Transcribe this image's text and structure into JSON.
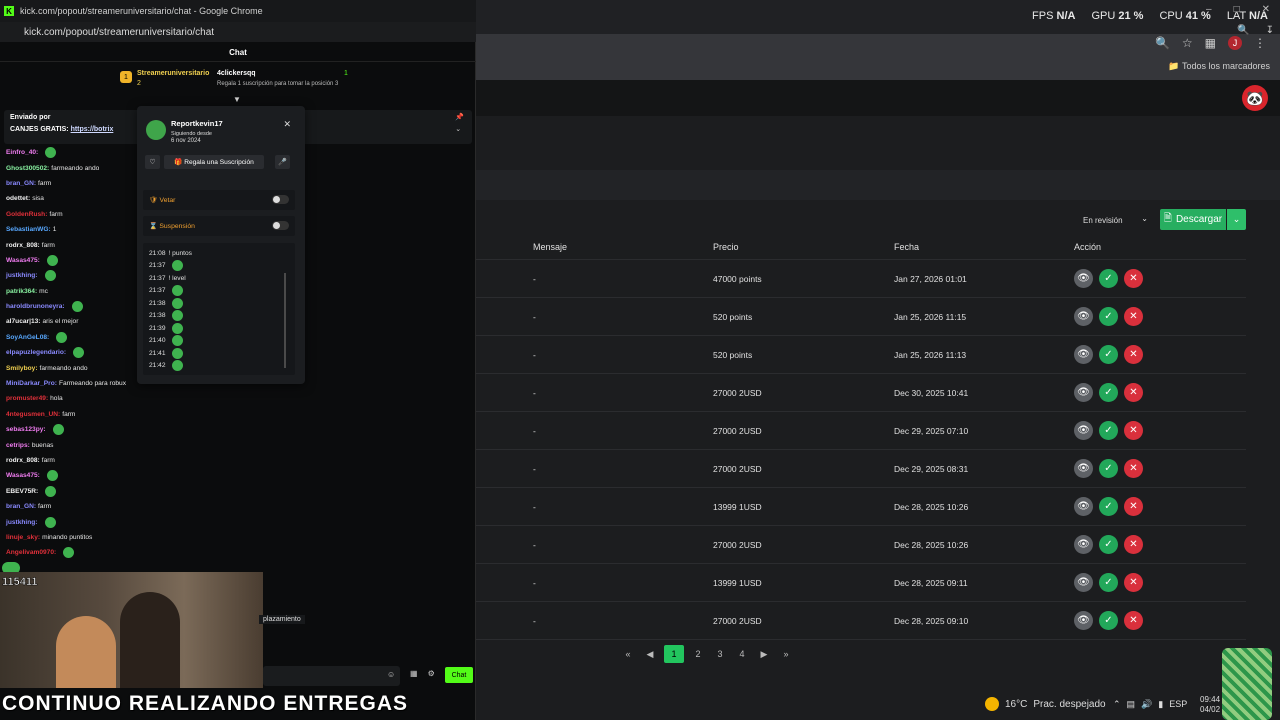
{
  "chrome": {
    "title": "kick.com/popout/streameruniversitario/chat - Google Chrome",
    "url": "kick.com/popout/streameruniversitario/chat"
  },
  "chat": {
    "header": "Chat",
    "leader": {
      "name": "Streameruniversitario",
      "count": "2",
      "gift_user": "4clickersqq",
      "gift_count": "1",
      "gift_hint": "Regala 1 suscripción para tomar la posición 3"
    },
    "pinned": {
      "sent_by": "Enviado por",
      "message_prefix": "CANJES GRATIS:",
      "link": "https://botrix"
    },
    "messages": [
      {
        "user": "Einfro_40:",
        "text": "",
        "color": "#f07cf0",
        "emote": true
      },
      {
        "user": "Ghost300502:",
        "text": "farmeando ando",
        "color": "#88f0a0",
        "emote": false
      },
      {
        "user": "bran_GN:",
        "text": "farm",
        "color": "#8a8aff",
        "emote": false
      },
      {
        "user": "odettet:",
        "text": "sisa",
        "color": "#f0f0f0",
        "emote": false
      },
      {
        "user": "GoldenRush:",
        "text": "farm",
        "color": "#e0303a",
        "emote": false
      },
      {
        "user": "SebastianWG:",
        "text": "1",
        "color": "#58a8ff",
        "emote": false
      },
      {
        "user": "rodrx_808:",
        "text": "farm",
        "color": "#f0f0f0",
        "emote": false
      },
      {
        "user": "Wasas475:",
        "text": "",
        "color": "#f07cf0",
        "emote": true
      },
      {
        "user": "justkhing:",
        "text": "",
        "color": "#8a8aff",
        "emote": true
      },
      {
        "user": "patrik364:",
        "text": "mc",
        "color": "#88f0a0",
        "emote": false
      },
      {
        "user": "haroldbrunoneyra:",
        "text": "",
        "color": "#8a8aff",
        "emote": true
      },
      {
        "user": "al7ucar|13:",
        "text": "aris el mejor",
        "color": "#f0f0f0",
        "emote": false
      },
      {
        "user": "SoyAnGeL08:",
        "text": "",
        "color": "#58a8ff",
        "emote": true
      },
      {
        "user": "elpapuzlegendario:",
        "text": "",
        "color": "#8a8aff",
        "emote": true
      },
      {
        "user": "Smilyboy:",
        "text": "farmeando ando",
        "color": "#f0d050",
        "emote": false
      },
      {
        "user": "MiniDarkar_Pro:",
        "text": "Farmeando para robux",
        "color": "#8a8aff",
        "emote": false
      },
      {
        "user": "promuster49:",
        "text": "hola",
        "color": "#e0303a",
        "emote": false
      },
      {
        "user": "4ntegusmen_UN:",
        "text": "farm",
        "color": "#e0303a",
        "emote": false
      },
      {
        "user": "sebas123py:",
        "text": "",
        "color": "#f07cf0",
        "emote": true
      },
      {
        "user": "cetrips:",
        "text": "buenas",
        "color": "#f07cf0",
        "emote": false
      },
      {
        "user": "rodrx_808:",
        "text": "farm",
        "color": "#f0f0f0",
        "emote": false
      },
      {
        "user": "Wasas475:",
        "text": "",
        "color": "#f07cf0",
        "emote": true
      },
      {
        "user": "EBEV75R:",
        "text": "",
        "color": "#f0f0f0",
        "emote": true
      },
      {
        "user": "bran_GN:",
        "text": "farm",
        "color": "#8a8aff",
        "emote": false
      },
      {
        "user": "justkhing:",
        "text": "",
        "color": "#8a8aff",
        "emote": true
      },
      {
        "user": "linuje_sky:",
        "text": "minando puntitos",
        "color": "#e0303a",
        "emote": false
      },
      {
        "user": "Angelivam0970:",
        "text": "",
        "color": "#e0303a",
        "emote": true
      }
    ],
    "reemplazo": "plazamiento",
    "send_label": "Chat"
  },
  "user_card": {
    "name": "Reportkevin17",
    "following": "Siguiendo desde",
    "date": "6 nov 2024",
    "gift_label": "Regala una Suscripción",
    "veto_label": "Vetar",
    "suspend_label": "Suspensión",
    "history": [
      {
        "time": "21:08",
        "text": "! puntos",
        "emote": false
      },
      {
        "time": "21:37",
        "text": "",
        "emote": true
      },
      {
        "time": "21:37",
        "text": "! level",
        "emote": false
      },
      {
        "time": "21:37",
        "text": "",
        "emote": true
      },
      {
        "time": "21:38",
        "text": "",
        "emote": true
      },
      {
        "time": "21:38",
        "text": "",
        "emote": true
      },
      {
        "time": "21:39",
        "text": "",
        "emote": true
      },
      {
        "time": "21:40",
        "text": "",
        "emote": true
      },
      {
        "time": "21:41",
        "text": "",
        "emote": true
      },
      {
        "time": "21:42",
        "text": "",
        "emote": true
      }
    ]
  },
  "webcam": {
    "counter": "115411"
  },
  "caption": "CONTINUO REALIZANDO ENTREGAS",
  "perf": {
    "fps_label": "FPS",
    "fps": "N/A",
    "gpu_label": "GPU",
    "gpu": "21 %",
    "cpu_label": "CPU",
    "cpu": "41 %",
    "lat_label": "LAT",
    "lat": "N/A"
  },
  "bookmarks": "Todos los marcadores",
  "avatar_letter": "J",
  "admin": {
    "status_filter": "En revisión",
    "download_label": "Descargar",
    "columns": {
      "message": "Mensaje",
      "price": "Precio",
      "date": "Fecha",
      "action": "Acción"
    },
    "rows": [
      {
        "message": "-",
        "price": "47000 points",
        "date": "Jan 27, 2026 01:01"
      },
      {
        "message": "-",
        "price": "520 points",
        "date": "Jan 25, 2026 11:15"
      },
      {
        "message": "-",
        "price": "520 points",
        "date": "Jan 25, 2026 11:13"
      },
      {
        "message": "-",
        "price": "27000 2USD",
        "date": "Dec 30, 2025 10:41"
      },
      {
        "message": "-",
        "price": "27000 2USD",
        "date": "Dec 29, 2025 07:10"
      },
      {
        "message": "-",
        "price": "27000 2USD",
        "date": "Dec 29, 2025 08:31"
      },
      {
        "message": "-",
        "price": "13999 1USD",
        "date": "Dec 28, 2025 10:26"
      },
      {
        "message": "-",
        "price": "27000 2USD",
        "date": "Dec 28, 2025 10:26"
      },
      {
        "message": "-",
        "price": "13999 1USD",
        "date": "Dec 28, 2025 09:11"
      },
      {
        "message": "-",
        "price": "27000 2USD",
        "date": "Dec 28, 2025 09:10"
      }
    ],
    "pages": [
      "1",
      "2",
      "3",
      "4"
    ],
    "active_page": "1"
  },
  "taskbar": {
    "weather": "16°C",
    "weather_desc": "Prac. despejado",
    "lang": "ESP",
    "time": "09:44",
    "date": "04/02"
  }
}
